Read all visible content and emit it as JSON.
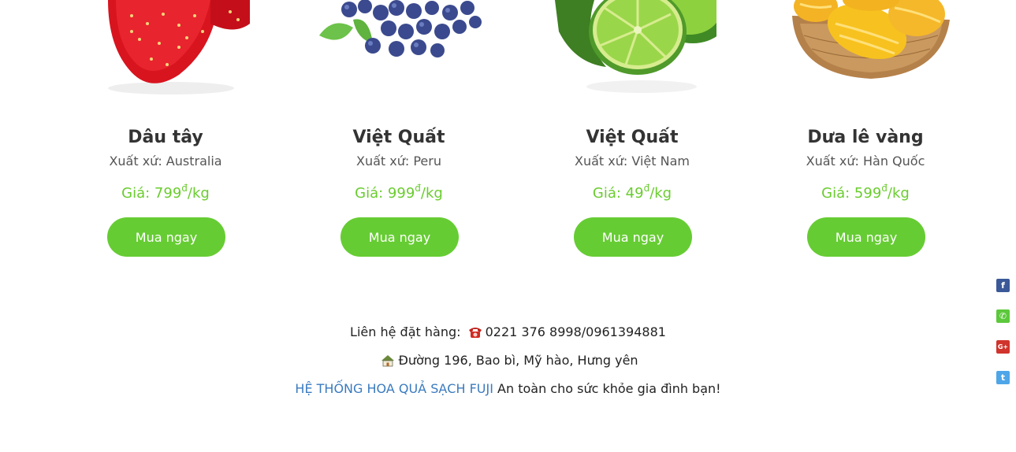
{
  "products": [
    {
      "name": "Dâu tây",
      "origin": "Xuất xứ: Australia",
      "price_prefix": "Giá: 799",
      "currency": "đ",
      "unit": "/kg",
      "button": "Mua ngay",
      "image_icon": "strawberry-image"
    },
    {
      "name": "Việt Quất",
      "origin": "Xuất xứ: Peru",
      "price_prefix": "Giá: 999",
      "currency": "đ",
      "unit": "/kg",
      "button": "Mua ngay",
      "image_icon": "blueberry-image"
    },
    {
      "name": "Việt Quất",
      "origin": "Xuất xứ: Việt Nam",
      "price_prefix": "Giá: 49",
      "currency": "đ",
      "unit": "/kg",
      "button": "Mua ngay",
      "image_icon": "lime-image"
    },
    {
      "name": "Dưa lê vàng",
      "origin": "Xuất xứ: Hàn Quốc",
      "price_prefix": "Giá: 599",
      "currency": "đ",
      "unit": "/kg",
      "button": "Mua ngay",
      "image_icon": "yellow-melon-image"
    }
  ],
  "footer": {
    "contact_label": "Liên hệ đặt hàng:",
    "phone": "0221 376 8998/0961394881",
    "address": "Đường 196, Bao bì, Mỹ hào, Hưng yên",
    "brand": "HỆ THỐNG HOA QUẢ SẠCH FUJI",
    "tagline": "An toàn cho sức khỏe gia đình bạn!"
  },
  "social": [
    {
      "icon": "facebook-icon",
      "glyph": "f",
      "color": "#3b5998"
    },
    {
      "icon": "phone-icon",
      "glyph": "✆",
      "color": "#5cc83b"
    },
    {
      "icon": "google-plus-icon",
      "glyph": "G+",
      "color": "#d0342c"
    },
    {
      "icon": "twitter-icon",
      "glyph": "t",
      "color": "#4ea6e8"
    }
  ],
  "colors": {
    "accent": "#66cc33",
    "price": "#6acc2f",
    "brand_link": "#3a7bbf"
  }
}
